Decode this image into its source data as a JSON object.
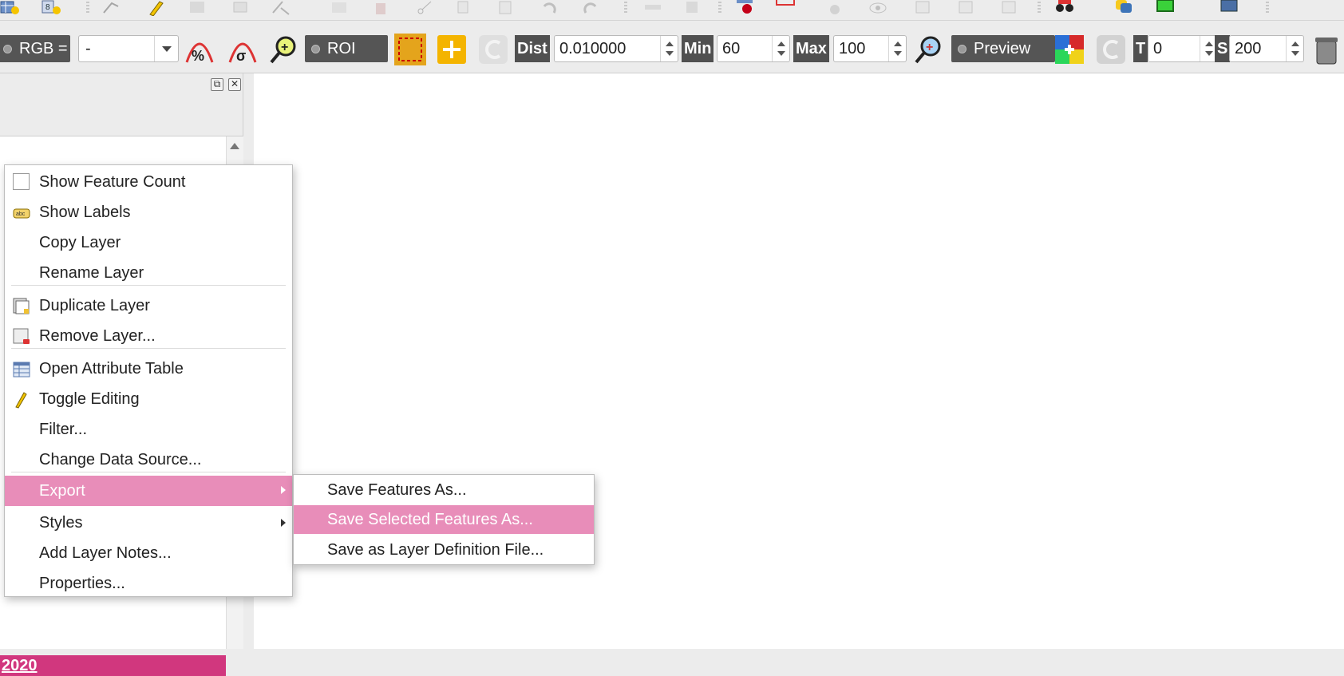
{
  "toolbar2": {
    "rgb_label": "RGB =",
    "rgb_value": "-",
    "roi_label": "ROI",
    "dist_label": "Dist",
    "dist_value": "0.010000",
    "min_label": "Min",
    "min_value": "60",
    "max_label": "Max",
    "max_value": "100",
    "preview_label": "Preview",
    "t_label": "T",
    "t_value": "0",
    "s_label": "S",
    "s_value": "200"
  },
  "layers_panel": {
    "selected_layer_text": "2020"
  },
  "context_menu": {
    "items": [
      {
        "label": "Show Feature Count",
        "icon": "checkbox-icon"
      },
      {
        "label": "Show Labels",
        "icon": "labels-icon"
      },
      {
        "label": "Copy Layer",
        "icon": ""
      },
      {
        "label": "Rename Layer",
        "icon": ""
      },
      {
        "label": "Duplicate Layer",
        "icon": "duplicate-layer-icon"
      },
      {
        "label": "Remove Layer...",
        "icon": "remove-layer-icon"
      },
      {
        "label": "Open Attribute Table",
        "icon": "attribute-table-icon"
      },
      {
        "label": "Toggle Editing",
        "icon": "pencil-icon"
      },
      {
        "label": "Filter...",
        "icon": ""
      },
      {
        "label": "Change Data Source...",
        "icon": ""
      },
      {
        "label": "Export",
        "icon": "",
        "submenu": true,
        "active": true
      },
      {
        "label": "Styles",
        "icon": "",
        "submenu": true
      },
      {
        "label": "Add Layer Notes...",
        "icon": ""
      },
      {
        "label": "Properties...",
        "icon": ""
      }
    ]
  },
  "export_submenu": {
    "items": [
      {
        "label": "Save Features As..."
      },
      {
        "label": "Save Selected Features As...",
        "active": true
      },
      {
        "label": "Save as Layer Definition File..."
      }
    ]
  },
  "colors": {
    "highlight": "#e88db9",
    "selected_layer": "#d1377e",
    "toolbar_bg": "#ececec"
  }
}
